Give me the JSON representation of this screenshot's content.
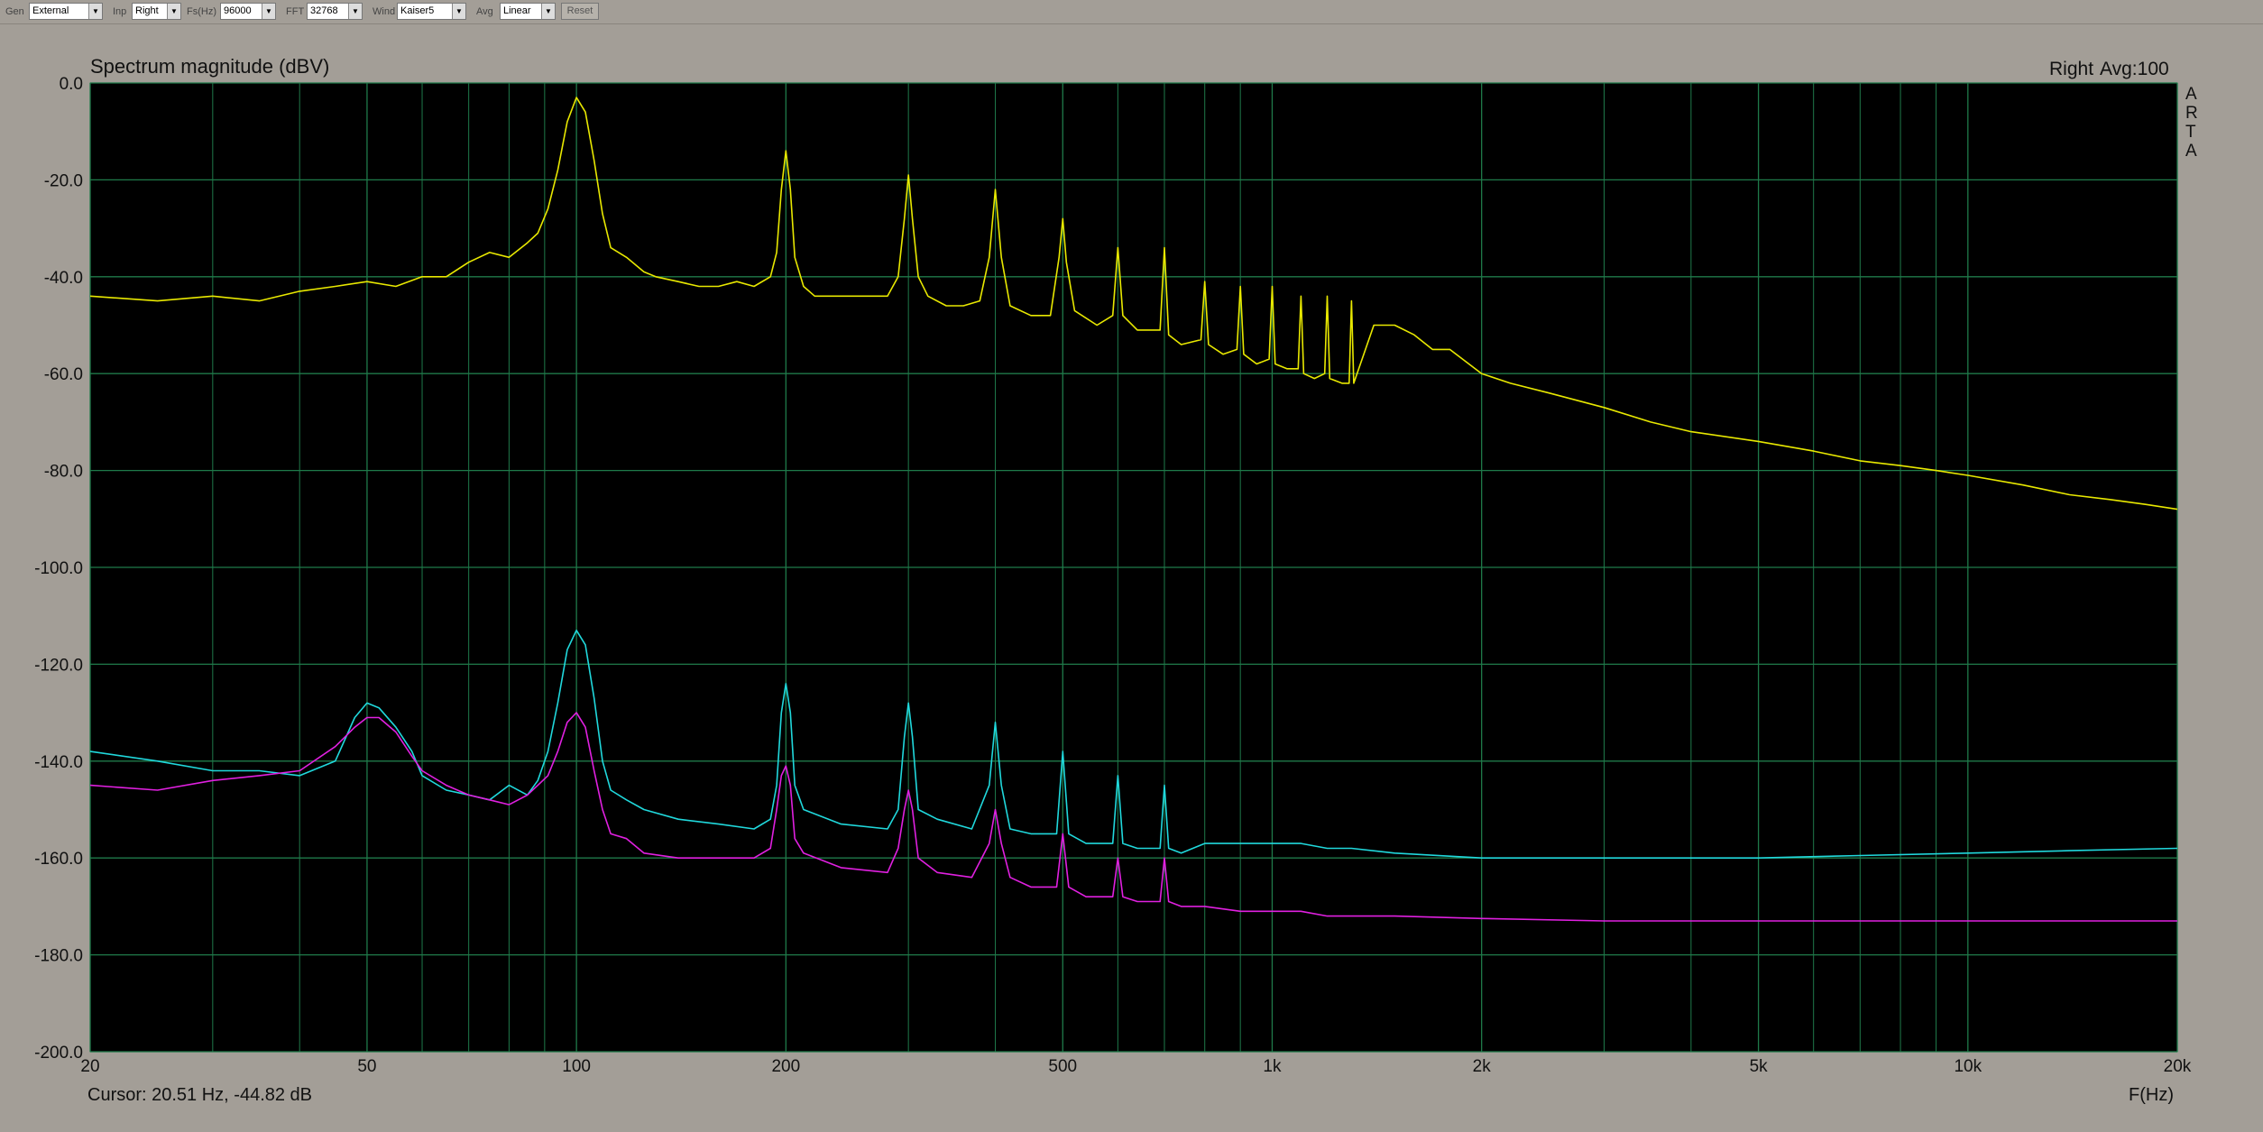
{
  "toolbar": {
    "gen_label": "Gen",
    "gen_value": "External",
    "inp_label": "Inp",
    "inp_value": "Right",
    "fs_label": "Fs(Hz)",
    "fs_value": "96000",
    "fft_label": "FFT",
    "fft_value": "32768",
    "wind_label": "Wind",
    "wind_value": "Kaiser5",
    "avg_label": "Avg",
    "avg_value": "Linear",
    "reset_label": "Reset"
  },
  "header": {
    "channel": "Right",
    "avg": "Avg:100",
    "brand_letters": [
      "A",
      "R",
      "T",
      "A"
    ]
  },
  "footer": {
    "cursor": "Cursor: 20.51 Hz, -44.82 dB"
  },
  "colors": {
    "plot_background": "#000000",
    "grid": "#1f7a4a",
    "series_yellow": "#e8e800",
    "series_cyan": "#20d8dc",
    "series_magenta": "#e020e0"
  },
  "chart_data": {
    "type": "line",
    "title": "Spectrum magnitude (dBV)",
    "xlabel": "F(Hz)",
    "ylabel": "",
    "xscale": "log",
    "xlim": [
      20,
      20000
    ],
    "ylim": [
      -200,
      0
    ],
    "grid": true,
    "y_ticks": [
      0,
      -20,
      -40,
      -60,
      -80,
      -100,
      -120,
      -140,
      -160,
      -180,
      -200
    ],
    "y_tick_labels": [
      "0.0",
      "-20.0",
      "-40.0",
      "-60.0",
      "-80.0",
      "-100.0",
      "-120.0",
      "-140.0",
      "-160.0",
      "-180.0",
      "-200.0"
    ],
    "x_ticks": [
      20,
      50,
      100,
      200,
      500,
      1000,
      2000,
      5000,
      10000,
      20000
    ],
    "x_tick_labels": [
      "20",
      "50",
      "100",
      "200",
      "500",
      "1k",
      "2k",
      "5k",
      "10k",
      "20k"
    ],
    "x_minor_grid": [
      30,
      40,
      60,
      70,
      80,
      90,
      300,
      400,
      600,
      700,
      800,
      900,
      3000,
      4000,
      6000,
      7000,
      8000,
      9000
    ],
    "series": [
      {
        "color": "#e8e800",
        "x": [
          20,
          25,
          30,
          35,
          40,
          45,
          50,
          55,
          60,
          65,
          70,
          75,
          80,
          85,
          88,
          91,
          94,
          97,
          100,
          103,
          106,
          109,
          112,
          118,
          125,
          130,
          140,
          150,
          160,
          170,
          180,
          190,
          194,
          197,
          200,
          203,
          206,
          212,
          220,
          240,
          260,
          280,
          290,
          296,
          300,
          304,
          310,
          320,
          340,
          360,
          380,
          392,
          400,
          408,
          420,
          450,
          480,
          494,
          500,
          506,
          520,
          560,
          590,
          600,
          610,
          640,
          690,
          700,
          710,
          740,
          790,
          800,
          810,
          850,
          890,
          900,
          910,
          950,
          990,
          1000,
          1010,
          1050,
          1090,
          1100,
          1110,
          1150,
          1190,
          1200,
          1210,
          1260,
          1290,
          1300,
          1310,
          1400,
          1500,
          1600,
          1700,
          1800,
          2000,
          2200,
          2500,
          3000,
          3500,
          4000,
          5000,
          6000,
          7000,
          8000,
          9000,
          10000,
          12000,
          14000,
          16000,
          18000,
          20000
        ],
        "y": [
          -44,
          -45,
          -44,
          -45,
          -43,
          -42,
          -41,
          -42,
          -40,
          -40,
          -37,
          -35,
          -36,
          -33,
          -31,
          -26,
          -18,
          -8,
          -3,
          -6,
          -16,
          -27,
          -34,
          -36,
          -39,
          -40,
          -41,
          -42,
          -42,
          -41,
          -42,
          -40,
          -35,
          -22,
          -14,
          -22,
          -36,
          -42,
          -44,
          -44,
          -44,
          -44,
          -40,
          -28,
          -19,
          -28,
          -40,
          -44,
          -46,
          -46,
          -45,
          -36,
          -22,
          -36,
          -46,
          -48,
          -48,
          -36,
          -28,
          -37,
          -47,
          -50,
          -48,
          -34,
          -48,
          -51,
          -51,
          -34,
          -52,
          -54,
          -53,
          -41,
          -54,
          -56,
          -55,
          -42,
          -56,
          -58,
          -57,
          -42,
          -58,
          -59,
          -59,
          -44,
          -60,
          -61,
          -60,
          -44,
          -61,
          -62,
          -62,
          -45,
          -62,
          -50,
          -50,
          -52,
          -55,
          -55,
          -60,
          -62,
          -64,
          -67,
          -70,
          -72,
          -74,
          -76,
          -78,
          -79,
          -80,
          -81,
          -83,
          -85,
          -86,
          -87,
          -88
        ]
      },
      {
        "color": "#20d8dc",
        "x": [
          20,
          25,
          30,
          35,
          40,
          45,
          48,
          50,
          52,
          55,
          58,
          60,
          65,
          70,
          75,
          80,
          85,
          88,
          91,
          94,
          97,
          100,
          103,
          106,
          109,
          112,
          118,
          125,
          140,
          160,
          180,
          190,
          194,
          197,
          200,
          203,
          206,
          212,
          240,
          280,
          290,
          296,
          300,
          304,
          310,
          330,
          370,
          392,
          400,
          408,
          420,
          450,
          490,
          500,
          510,
          540,
          590,
          600,
          610,
          640,
          690,
          700,
          710,
          740,
          800,
          900,
          1000,
          1100,
          1200,
          1300,
          1500,
          2000,
          3000,
          5000,
          7000,
          10000,
          14000,
          20000
        ],
        "y": [
          -138,
          -140,
          -142,
          -142,
          -143,
          -140,
          -131,
          -128,
          -129,
          -133,
          -138,
          -143,
          -146,
          -147,
          -148,
          -145,
          -147,
          -144,
          -138,
          -128,
          -117,
          -113,
          -116,
          -127,
          -140,
          -146,
          -148,
          -150,
          -152,
          -153,
          -154,
          -152,
          -145,
          -130,
          -124,
          -130,
          -145,
          -150,
          -153,
          -154,
          -150,
          -135,
          -128,
          -135,
          -150,
          -152,
          -154,
          -145,
          -132,
          -145,
          -154,
          -155,
          -155,
          -138,
          -155,
          -157,
          -157,
          -143,
          -157,
          -158,
          -158,
          -145,
          -158,
          -159,
          -157,
          -157,
          -157,
          -157,
          -158,
          -158,
          -159,
          -160,
          -160,
          -160,
          -159.5,
          -159,
          -158.5,
          -158
        ]
      },
      {
        "color": "#e020e0",
        "x": [
          20,
          25,
          30,
          35,
          40,
          45,
          48,
          50,
          52,
          55,
          58,
          60,
          65,
          70,
          75,
          80,
          85,
          88,
          91,
          94,
          97,
          100,
          103,
          106,
          109,
          112,
          118,
          125,
          140,
          160,
          180,
          190,
          194,
          197,
          200,
          203,
          206,
          212,
          240,
          280,
          290,
          296,
          300,
          304,
          310,
          330,
          370,
          392,
          400,
          408,
          420,
          450,
          490,
          500,
          510,
          540,
          590,
          600,
          610,
          640,
          690,
          700,
          710,
          740,
          800,
          900,
          1000,
          1100,
          1200,
          1300,
          1500,
          2000,
          3000,
          5000,
          7000,
          10000,
          14000,
          20000
        ],
        "y": [
          -145,
          -146,
          -144,
          -143,
          -142,
          -137,
          -133,
          -131,
          -131,
          -134,
          -139,
          -142,
          -145,
          -147,
          -148,
          -149,
          -147,
          -145,
          -143,
          -138,
          -132,
          -130,
          -133,
          -142,
          -150,
          -155,
          -156,
          -159,
          -160,
          -160,
          -160,
          -158,
          -150,
          -143,
          -141,
          -145,
          -156,
          -159,
          -162,
          -163,
          -158,
          -150,
          -146,
          -150,
          -160,
          -163,
          -164,
          -157,
          -150,
          -157,
          -164,
          -166,
          -166,
          -155,
          -166,
          -168,
          -168,
          -160,
          -168,
          -169,
          -169,
          -160,
          -169,
          -170,
          -170,
          -171,
          -171,
          -171,
          -172,
          -172,
          -172,
          -172.5,
          -173,
          -173,
          -173,
          -173,
          -173,
          -173
        ]
      }
    ]
  }
}
